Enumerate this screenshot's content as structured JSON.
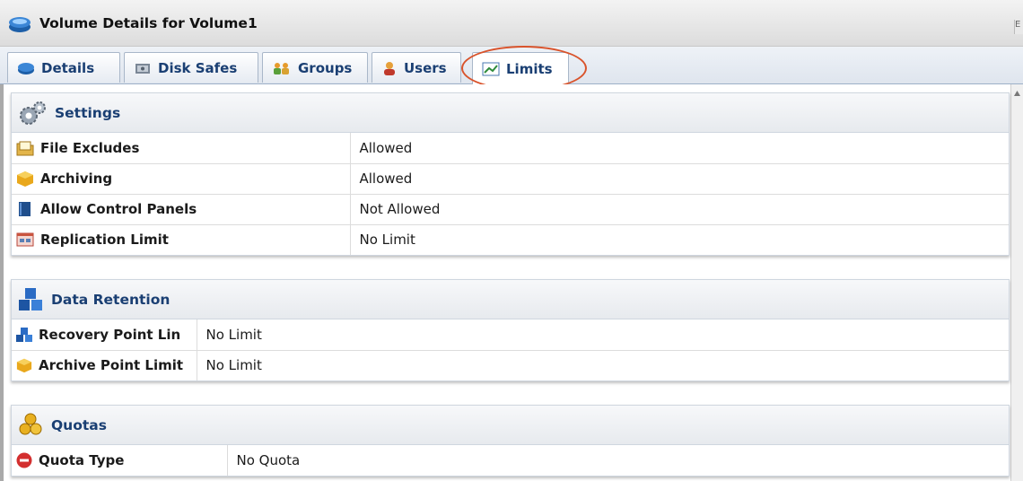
{
  "window": {
    "title": "Volume Details for Volume1",
    "title_icon": "volume-icon"
  },
  "tabs": [
    {
      "label": "Details",
      "icon": "volume-icon",
      "active": false
    },
    {
      "label": "Disk Safes",
      "icon": "disk-safe-icon",
      "active": false
    },
    {
      "label": "Groups",
      "icon": "groups-icon",
      "active": false
    },
    {
      "label": "Users",
      "icon": "user-icon",
      "active": false
    },
    {
      "label": "Limits",
      "icon": "chart-icon",
      "active": true
    }
  ],
  "settings": {
    "title": "Settings",
    "icon": "gears-icon",
    "rows": [
      {
        "label": "File Excludes",
        "value": "Allowed",
        "icon": "folder-icon"
      },
      {
        "label": "Archiving",
        "value": "Allowed",
        "icon": "archive-cube-icon"
      },
      {
        "label": "Allow Control Panels",
        "value": "Not Allowed",
        "icon": "control-panel-book-icon"
      },
      {
        "label": "Replication Limit",
        "value": "No Limit",
        "icon": "replication-icon"
      }
    ]
  },
  "data_retention": {
    "title": "Data Retention",
    "icon": "cubes-icon",
    "rows": [
      {
        "label": "Recovery Point Lin",
        "value": "No Limit",
        "icon": "recovery-cubes-icon"
      },
      {
        "label": "Archive Point Limit",
        "value": "No Limit",
        "icon": "archive-cube-icon"
      }
    ]
  },
  "quotas": {
    "title": "Quotas",
    "icon": "coins-icon",
    "rows": [
      {
        "label": "Quota Type",
        "value": "No Quota",
        "icon": "no-entry-icon"
      }
    ]
  },
  "colors": {
    "accent": "#1a3f73",
    "highlight_ring": "#d9532b"
  }
}
